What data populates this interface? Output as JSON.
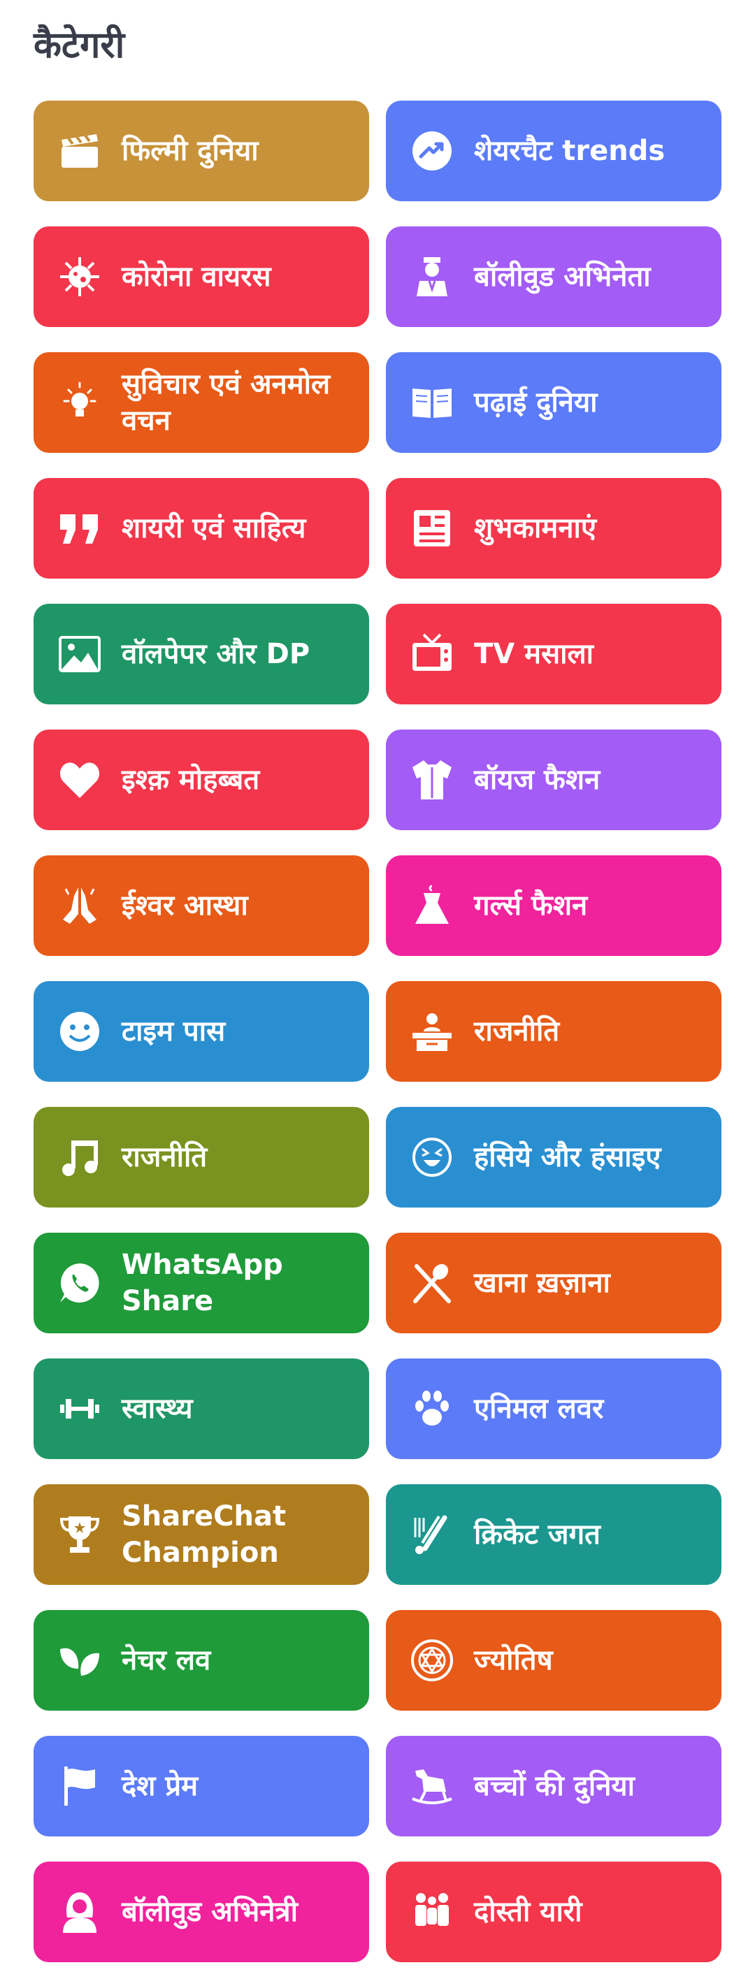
{
  "header": {
    "title": "कैटेगरी"
  },
  "tiles": [
    {
      "label": "फिल्मी दुनिया",
      "color": "#c8923a",
      "icon": "clapperboard-icon"
    },
    {
      "label": "शेयरचैट trends",
      "color": "#5b7bf8",
      "icon": "trending-icon"
    },
    {
      "label": "कोरोना वायरस",
      "color": "#f3364b",
      "icon": "virus-icon"
    },
    {
      "label": "बॉलीवुड अभिनेता",
      "color": "#a35cf5",
      "icon": "actor-icon"
    },
    {
      "label": "सुविचार एवं अनमोल वचन",
      "color": "#e85a17",
      "icon": "lightbulb-icon"
    },
    {
      "label": "पढ़ाई दुनिया",
      "color": "#5b7bf8",
      "icon": "book-icon"
    },
    {
      "label": "शायरी एवं साहित्य",
      "color": "#f3364b",
      "icon": "quote-icon"
    },
    {
      "label": "शुभकामनाएं",
      "color": "#f3364b",
      "icon": "newspaper-icon"
    },
    {
      "label": "वॉलपेपर और DP",
      "color": "#1f9666",
      "icon": "image-icon"
    },
    {
      "label": "TV मसाला",
      "color": "#f3364b",
      "icon": "tv-icon"
    },
    {
      "label": "इश्क़ मोहब्बत",
      "color": "#f3364b",
      "icon": "heart-icon"
    },
    {
      "label": "बॉयज फैशन",
      "color": "#a35cf5",
      "icon": "shirt-icon"
    },
    {
      "label": "ईश्वर आस्था",
      "color": "#e85a17",
      "icon": "praying-hands-icon"
    },
    {
      "label": "गर्ल्स फैशन",
      "color": "#f0229c",
      "icon": "dress-icon"
    },
    {
      "label": "टाइम पास",
      "color": "#2a8fd1",
      "icon": "smiley-icon"
    },
    {
      "label": "राजनीति",
      "color": "#e85a17",
      "icon": "podium-icon"
    },
    {
      "label": "राजनीति",
      "color": "#7a9220",
      "icon": "music-note-icon"
    },
    {
      "label": "हंसिये और हंसाइए",
      "color": "#2a8fd1",
      "icon": "laugh-icon"
    },
    {
      "label": "WhatsApp Share",
      "color": "#1f9b3a",
      "icon": "whatsapp-icon"
    },
    {
      "label": "खाना ख़ज़ाना",
      "color": "#e85a17",
      "icon": "fork-spoon-icon"
    },
    {
      "label": "स्वास्थ्य",
      "color": "#1f9666",
      "icon": "dumbbell-icon"
    },
    {
      "label": "एनिमल लवर",
      "color": "#5b7bf8",
      "icon": "paw-icon"
    },
    {
      "label": "ShareChat Champion",
      "color": "#b07d1e",
      "icon": "trophy-icon"
    },
    {
      "label": "क्रिकेट जगत",
      "color": "#1b978f",
      "icon": "cricket-icon"
    },
    {
      "label": "नेचर लव",
      "color": "#1f9b3a",
      "icon": "leaves-icon"
    },
    {
      "label": "ज्योतिष",
      "color": "#e85a17",
      "icon": "star-wheel-icon"
    },
    {
      "label": "देश प्रेम",
      "color": "#5b7bf8",
      "icon": "flag-icon"
    },
    {
      "label": "बच्चों की दुनिया",
      "color": "#a35cf5",
      "icon": "rocking-horse-icon"
    },
    {
      "label": "बॉलीवुड अभिनेत्री",
      "color": "#f0229c",
      "icon": "actress-icon"
    },
    {
      "label": "दोस्ती यारी",
      "color": "#f3364b",
      "icon": "friends-icon"
    }
  ]
}
